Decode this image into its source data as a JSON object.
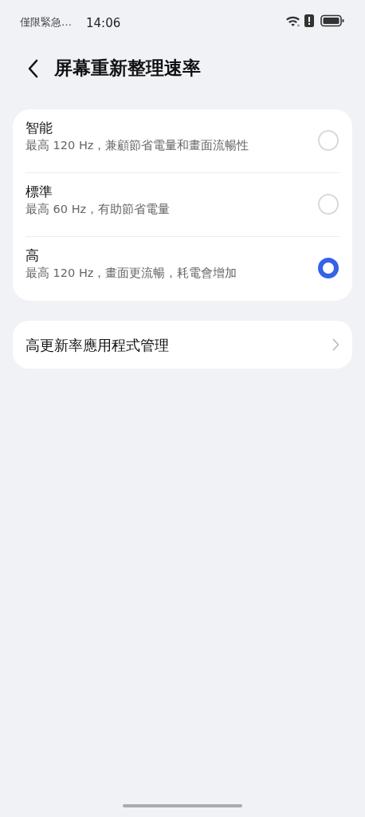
{
  "status_bar": {
    "carrier": "僅限緊急…",
    "time": "14:06"
  },
  "header": {
    "title": "屏幕重新整理速率"
  },
  "options": [
    {
      "title": "智能",
      "subtitle": "最高 120 Hz，兼顧節省電量和畫面流暢性",
      "selected": false
    },
    {
      "title": "標準",
      "subtitle": "最高 60 Hz，有助節省電量",
      "selected": false
    },
    {
      "title": "高",
      "subtitle": "最高 120 Hz，畫面更流暢，耗電會增加",
      "selected": true
    }
  ],
  "links": [
    {
      "label": "高更新率應用程式管理"
    }
  ]
}
